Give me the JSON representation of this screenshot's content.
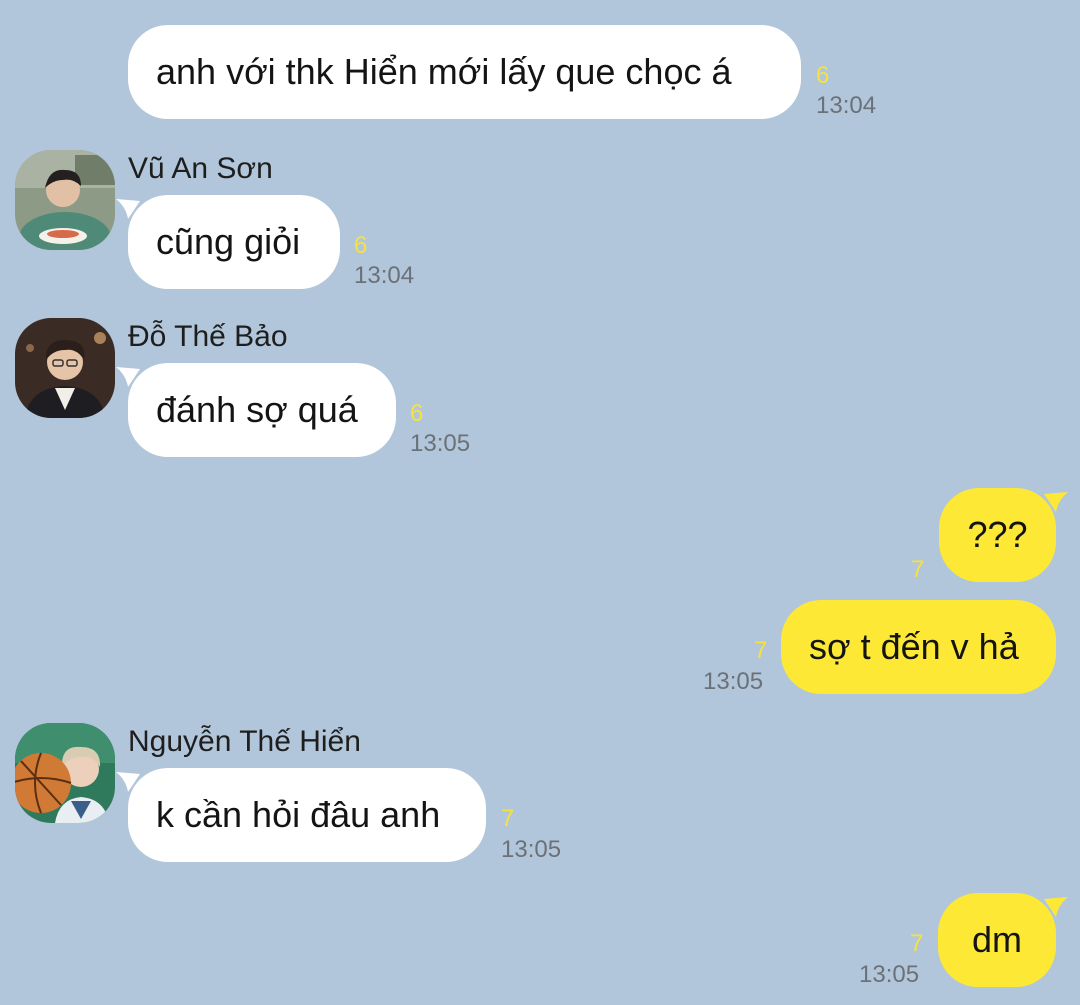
{
  "messages": [
    {
      "text": "anh với thk Hiển mới lấy que chọc á",
      "unread": "6",
      "time": "13:04"
    },
    {
      "sender": "Vũ An Sơn",
      "text": "cũng giỏi",
      "unread": "6",
      "time": "13:04"
    },
    {
      "sender": "Đỗ Thế Bảo",
      "text": "đánh sợ quá",
      "unread": "6",
      "time": "13:05"
    },
    {
      "text": "???",
      "unread": "7"
    },
    {
      "text": "sợ t đến v hả",
      "unread": "7",
      "time": "13:05"
    },
    {
      "sender": "Nguyễn Thế Hiển",
      "text": "k cần hỏi đâu anh",
      "unread": "7",
      "time": "13:05"
    },
    {
      "text": "dm",
      "unread": "7",
      "time": "13:05"
    }
  ],
  "colors": {
    "background": "#b1c6da",
    "incoming_bubble": "#ffffff",
    "outgoing_bubble": "#fde935",
    "unread_count": "#f6e23b",
    "timestamp": "#6c7178"
  }
}
